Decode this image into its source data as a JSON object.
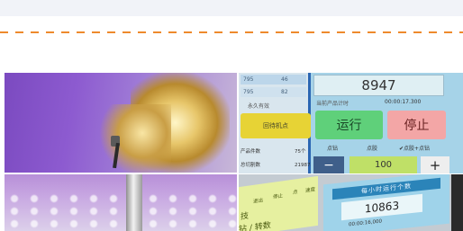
{
  "panel": {
    "left_rows": [
      {
        "c1": "795",
        "c2": "46"
      },
      {
        "c1": "795",
        "c2": "82"
      }
    ],
    "left_label": "永久有效",
    "home_button": "回待机点",
    "count_label": "产品件数",
    "count_value": "75个",
    "total_label": "总切割数",
    "total_value": "21987颗",
    "counter": "8947",
    "time_label": "当前产品计时",
    "time_value": "00:00:17.300",
    "run_button": "运行",
    "stop_button": "停止",
    "options": [
      "点钻",
      "点胶",
      "✔点胶+点钻"
    ],
    "qty_minus": "−",
    "qty_value": "100",
    "qty_plus": "+"
  },
  "panel2": {
    "tabs": [
      "技",
      "退出",
      "停止",
      "点",
      "速度"
    ],
    "big_text": "钻 / 转数",
    "head": "每小时运行个数",
    "value": "10863",
    "time": "00:00:16,000"
  }
}
